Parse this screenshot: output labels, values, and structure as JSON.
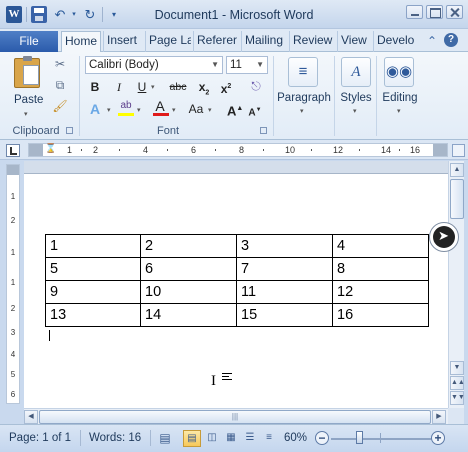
{
  "window": {
    "title": "Document1 - Microsoft Word",
    "app_icon_letter": "W"
  },
  "tabs": {
    "file": "File",
    "items": [
      "Home",
      "Insert",
      "Page La",
      "Referer",
      "Mailing",
      "Review",
      "View",
      "Develo"
    ],
    "active": "Home"
  },
  "ribbon": {
    "clipboard": {
      "paste_label": "Paste",
      "group_label": "Clipboard"
    },
    "font": {
      "font_name": "Calibri (Body)",
      "font_size": "11",
      "bold": "B",
      "italic": "I",
      "underline": "U",
      "strike": "abc",
      "subscript": "x",
      "superscript": "x",
      "highlight": "ab",
      "font_color_letter": "A",
      "change_case": "Aa",
      "grow": "A",
      "shrink": "A",
      "text_effects": "A",
      "group_label": "Font"
    },
    "paragraph_label": "Paragraph",
    "styles_label": "Styles",
    "editing_label": "Editing"
  },
  "ruler": {
    "numbers": [
      "1",
      "2",
      "4",
      "6",
      "8",
      "10",
      "12",
      "14",
      "16"
    ],
    "vertical_numbers": [
      "1",
      "2",
      "1",
      "1",
      "2",
      "3",
      "4",
      "5",
      "6"
    ]
  },
  "document": {
    "table": [
      [
        "1",
        "2",
        "3",
        "4"
      ],
      [
        "5",
        "6",
        "7",
        "8"
      ],
      [
        "9",
        "10",
        "11",
        "12"
      ],
      [
        "13",
        "14",
        "15",
        "16"
      ]
    ]
  },
  "status": {
    "page": "Page: 1 of 1",
    "words": "Words: 16",
    "zoom": "60%",
    "zoom_level_percent": 60
  },
  "colors": {
    "accent": "#2b5797",
    "file_tab": "#2b5bab",
    "ribbon_bg": "#e2ecf7",
    "font_color_bar": "#e01b1b",
    "highlight_bar": "#ffff00"
  }
}
